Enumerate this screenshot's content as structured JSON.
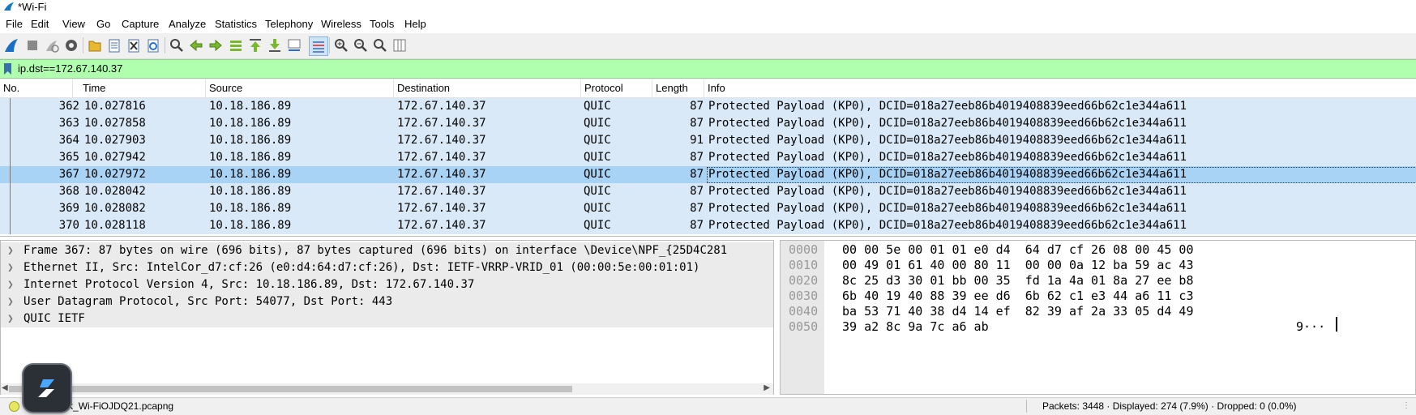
{
  "window": {
    "title": "*Wi-Fi"
  },
  "menu": [
    "File",
    "Edit",
    "View",
    "Go",
    "Capture",
    "Analyze",
    "Statistics",
    "Telephony",
    "Wireless",
    "Tools",
    "Help"
  ],
  "toolbar": {
    "icons": [
      "shark-fin-start-icon",
      "stop-capture-icon",
      "restart-capture-icon",
      "capture-options-icon",
      "open-file-icon",
      "save-file-icon",
      "close-file-icon",
      "reload-file-icon",
      "find-packet-icon",
      "go-back-icon",
      "go-forward-icon",
      "go-to-packet-icon",
      "go-first-icon",
      "go-last-icon",
      "auto-scroll-icon",
      "colorize-icon",
      "zoom-in-icon",
      "zoom-out-icon",
      "zoom-normal-icon",
      "resize-columns-icon"
    ]
  },
  "filter": {
    "value": "ip.dst==172.67.140.37"
  },
  "packet_list": {
    "columns": [
      "No.",
      "Time",
      "Source",
      "Destination",
      "Protocol",
      "Length",
      "Info"
    ],
    "rows": [
      {
        "no": "362",
        "time": "10.027816",
        "src": "10.18.186.89",
        "dst": "172.67.140.37",
        "proto": "QUIC",
        "len": "87",
        "info": "Protected Payload (KP0), DCID=018a27eeb86b4019408839eed66b62c1e344a611"
      },
      {
        "no": "363",
        "time": "10.027858",
        "src": "10.18.186.89",
        "dst": "172.67.140.37",
        "proto": "QUIC",
        "len": "87",
        "info": "Protected Payload (KP0), DCID=018a27eeb86b4019408839eed66b62c1e344a611"
      },
      {
        "no": "364",
        "time": "10.027903",
        "src": "10.18.186.89",
        "dst": "172.67.140.37",
        "proto": "QUIC",
        "len": "91",
        "info": "Protected Payload (KP0), DCID=018a27eeb86b4019408839eed66b62c1e344a611"
      },
      {
        "no": "365",
        "time": "10.027942",
        "src": "10.18.186.89",
        "dst": "172.67.140.37",
        "proto": "QUIC",
        "len": "87",
        "info": "Protected Payload (KP0), DCID=018a27eeb86b4019408839eed66b62c1e344a611"
      },
      {
        "no": "367",
        "time": "10.027972",
        "src": "10.18.186.89",
        "dst": "172.67.140.37",
        "proto": "QUIC",
        "len": "87",
        "info": "Protected Payload (KP0), DCID=018a27eeb86b4019408839eed66b62c1e344a611"
      },
      {
        "no": "368",
        "time": "10.028042",
        "src": "10.18.186.89",
        "dst": "172.67.140.37",
        "proto": "QUIC",
        "len": "87",
        "info": "Protected Payload (KP0), DCID=018a27eeb86b4019408839eed66b62c1e344a611"
      },
      {
        "no": "369",
        "time": "10.028082",
        "src": "10.18.186.89",
        "dst": "172.67.140.37",
        "proto": "QUIC",
        "len": "87",
        "info": "Protected Payload (KP0), DCID=018a27eeb86b4019408839eed66b62c1e344a611"
      },
      {
        "no": "370",
        "time": "10.028118",
        "src": "10.18.186.89",
        "dst": "172.67.140.37",
        "proto": "QUIC",
        "len": "87",
        "info": "Protected Payload (KP0), DCID=018a27eeb86b4019408839eed66b62c1e344a611"
      }
    ],
    "selected_no": "367"
  },
  "details": [
    "Frame 367: 87 bytes on wire (696 bits), 87 bytes captured (696 bits) on interface \\Device\\NPF_{25D4C281",
    "Ethernet II, Src: IntelCor_d7:cf:26 (e0:d4:64:d7:cf:26), Dst: IETF-VRRP-VRID_01 (00:00:5e:00:01:01)",
    "Internet Protocol Version 4, Src: 10.18.186.89, Dst: 172.67.140.37",
    "User Datagram Protocol, Src Port: 54077, Dst Port: 443",
    "QUIC IETF"
  ],
  "bytes": [
    {
      "off": "0000",
      "hex": "00 00 5e 00 01 01 e0 d4  64 d7 cf 26 08 00 45 00",
      "ascii": ""
    },
    {
      "off": "0010",
      "hex": "00 49 01 61 40 00 80 11  00 00 0a 12 ba 59 ac 43",
      "ascii": ""
    },
    {
      "off": "0020",
      "hex": "8c 25 d3 30 01 bb 00 35  fd 1a 4a 01 8a 27 ee b8",
      "ascii": ""
    },
    {
      "off": "0030",
      "hex": "6b 40 19 40 88 39 ee d6  6b 62 c1 e3 44 a6 11 c3",
      "ascii": ""
    },
    {
      "off": "0040",
      "hex": "ba 53 71 40 38 d4 14 ef  82 39 af 2a 33 05 d4 49",
      "ascii": ""
    },
    {
      "off": "0050",
      "hex": "39 a2 8c 9a 7c a6 ab",
      "ascii": "9···"
    }
  ],
  "status": {
    "file": "reshark_Wi-FiOJDQ21.pcapng",
    "stats": "Packets: 3448 · Displayed: 274 (7.9%) · Dropped: 0 (0.0%)"
  },
  "colors": {
    "row_bg": "#dae9f8",
    "row_selected": "#a9d3f5",
    "filter_ok": "#afffaf"
  }
}
